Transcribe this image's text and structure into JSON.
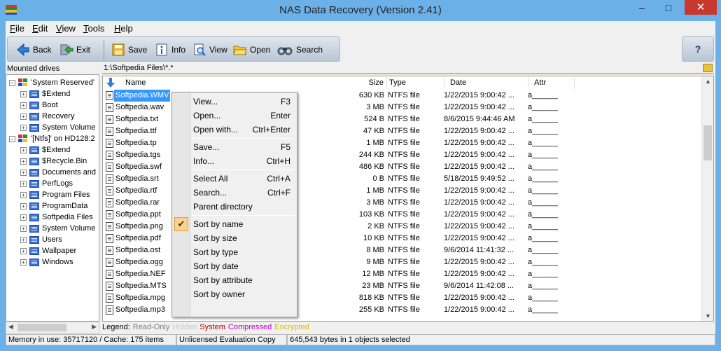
{
  "window": {
    "title": "NAS Data Recovery (Version 2.41)",
    "minimize": "–",
    "maximize": "□",
    "close": "✕"
  },
  "menu": [
    {
      "key": "F",
      "rest": "ile"
    },
    {
      "key": "E",
      "rest": "dit"
    },
    {
      "key": "V",
      "rest": "iew"
    },
    {
      "key": "T",
      "rest": "ools"
    },
    {
      "key": "H",
      "rest": "elp"
    }
  ],
  "toolbar": {
    "back": "Back",
    "exit": "Exit",
    "save": "Save",
    "info": "Info",
    "view": "View",
    "open": "Open",
    "search": "Search",
    "help": "?"
  },
  "left_panel": {
    "label": "Mounted drives",
    "tree": [
      {
        "level": 0,
        "label": "'System Reserved'",
        "type": "drive"
      },
      {
        "level": 1,
        "label": "$Extend",
        "type": "folder"
      },
      {
        "level": 1,
        "label": "Boot",
        "type": "folder"
      },
      {
        "level": 1,
        "label": "Recovery",
        "type": "folder"
      },
      {
        "level": 1,
        "label": "System Volume",
        "type": "folder"
      },
      {
        "level": 0,
        "label": "'[Ntfs]' on HD128:2",
        "type": "drive"
      },
      {
        "level": 1,
        "label": "$Extend",
        "type": "folder"
      },
      {
        "level": 1,
        "label": "$Recycle.Bin",
        "type": "folder"
      },
      {
        "level": 1,
        "label": "Documents and",
        "type": "folder"
      },
      {
        "level": 1,
        "label": "PerfLogs",
        "type": "folder"
      },
      {
        "level": 1,
        "label": "Program Files",
        "type": "folder"
      },
      {
        "level": 1,
        "label": "ProgramData",
        "type": "folder"
      },
      {
        "level": 1,
        "label": "Softpedia Files",
        "type": "folder"
      },
      {
        "level": 1,
        "label": "System Volume",
        "type": "folder"
      },
      {
        "level": 1,
        "label": "Users",
        "type": "folder"
      },
      {
        "level": 1,
        "label": "Wallpaper",
        "type": "folder"
      },
      {
        "level": 1,
        "label": "Windows",
        "type": "folder"
      }
    ]
  },
  "path": "1:\\Softpedia Files\\*.*",
  "columns": {
    "name": "Name",
    "size": "Size",
    "type": "Type",
    "date": "Date",
    "attr": "Attr"
  },
  "files": [
    {
      "name": "Softpedia.WMV",
      "size": "630 KB",
      "type": "NTFS file",
      "date": "1/22/2015 9:00:42 ...",
      "attr": "a______",
      "selected": true
    },
    {
      "name": "Softpedia.wav",
      "size": "3 MB",
      "type": "NTFS file",
      "date": "1/22/2015 9:00:42 ...",
      "attr": "a______"
    },
    {
      "name": "Softpedia.txt",
      "size": "524 B",
      "type": "NTFS file",
      "date": "8/6/2015 9:44:46 AM",
      "attr": "a______"
    },
    {
      "name": "Softpedia.ttf",
      "size": "47 KB",
      "type": "NTFS file",
      "date": "1/22/2015 9:00:42 ...",
      "attr": "a______"
    },
    {
      "name": "Softpedia.tp",
      "size": "1 MB",
      "type": "NTFS file",
      "date": "1/22/2015 9:00:42 ...",
      "attr": "a______"
    },
    {
      "name": "Softpedia.tgs",
      "size": "244 KB",
      "type": "NTFS file",
      "date": "1/22/2015 9:00:42 ...",
      "attr": "a______"
    },
    {
      "name": "Softpedia.swf",
      "size": "486 KB",
      "type": "NTFS file",
      "date": "1/22/2015 9:00:42 ...",
      "attr": "a______"
    },
    {
      "name": "Softpedia.srt",
      "size": "0 B",
      "type": "NTFS file",
      "date": "5/18/2015 9:49:52 ...",
      "attr": "a______"
    },
    {
      "name": "Softpedia.rtf",
      "size": "1 MB",
      "type": "NTFS file",
      "date": "1/22/2015 9:00:42 ...",
      "attr": "a______"
    },
    {
      "name": "Softpedia.rar",
      "size": "3 MB",
      "type": "NTFS file",
      "date": "1/22/2015 9:00:42 ...",
      "attr": "a______"
    },
    {
      "name": "Softpedia.ppt",
      "size": "103 KB",
      "type": "NTFS file",
      "date": "1/22/2015 9:00:42 ...",
      "attr": "a______"
    },
    {
      "name": "Softpedia.png",
      "size": "2 KB",
      "type": "NTFS file",
      "date": "1/22/2015 9:00:42 ...",
      "attr": "a______"
    },
    {
      "name": "Softpedia.pdf",
      "size": "10 KB",
      "type": "NTFS file",
      "date": "1/22/2015 9:00:42 ...",
      "attr": "a______"
    },
    {
      "name": "Softpedia.ost",
      "size": "8 MB",
      "type": "NTFS file",
      "date": "9/6/2014 11:41:32 ...",
      "attr": "a______"
    },
    {
      "name": "Softpedia.ogg",
      "size": "9 MB",
      "type": "NTFS file",
      "date": "1/22/2015 9:00:42 ...",
      "attr": "a______"
    },
    {
      "name": "Softpedia.NEF",
      "size": "12 MB",
      "type": "NTFS file",
      "date": "1/22/2015 9:00:42 ...",
      "attr": "a______"
    },
    {
      "name": "Softpedia.MTS",
      "size": "23 MB",
      "type": "NTFS file",
      "date": "9/6/2014 11:42:08 ...",
      "attr": "a______"
    },
    {
      "name": "Softpedia.mpg",
      "size": "818 KB",
      "type": "NTFS file",
      "date": "1/22/2015 9:00:42 ...",
      "attr": "a______"
    },
    {
      "name": "Softpedia.mp3",
      "size": "255 KB",
      "type": "NTFS file",
      "date": "1/22/2015 9:00:42 ...",
      "attr": "a______"
    }
  ],
  "context_menu": [
    {
      "label": "View...",
      "shortcut": "F3"
    },
    {
      "label": "Open...",
      "shortcut": "Enter"
    },
    {
      "label": "Open with...",
      "shortcut": "Ctrl+Enter"
    },
    {
      "sep": true
    },
    {
      "label": "Save...",
      "shortcut": "F5"
    },
    {
      "label": "Info...",
      "shortcut": "Ctrl+H"
    },
    {
      "sep": true
    },
    {
      "label": "Select All",
      "shortcut": "Ctrl+A"
    },
    {
      "label": "Search...",
      "shortcut": "Ctrl+F"
    },
    {
      "label": "Parent directory",
      "shortcut": ""
    },
    {
      "sep": true
    },
    {
      "label": "Sort by name",
      "shortcut": "",
      "checked": true
    },
    {
      "label": "Sort by size",
      "shortcut": ""
    },
    {
      "label": "Sort by type",
      "shortcut": ""
    },
    {
      "label": "Sort by date",
      "shortcut": ""
    },
    {
      "label": "Sort by attribute",
      "shortcut": ""
    },
    {
      "label": "Sort by owner",
      "shortcut": ""
    }
  ],
  "legend": {
    "label": "Legend:",
    "items": [
      {
        "text": "Read-Only",
        "color": "#808080"
      },
      {
        "text": "Hidden",
        "color": "#c8c8c8"
      },
      {
        "text": "System",
        "color": "#c00000"
      },
      {
        "text": "Compressed",
        "color": "#c000c0"
      },
      {
        "text": "Encrypted",
        "color": "#d8c000"
      }
    ]
  },
  "status": {
    "memory": "Memory in use: 35717120 / Cache: 175 items",
    "license": "Unlicensed Evaluation Copy",
    "selection": "645,543 bytes in 1 objects selected"
  },
  "colors": {
    "titlebar": "#6bb0e6",
    "selection": "#3399ff",
    "close": "#c7392d",
    "path_accent": "#f2b233"
  }
}
